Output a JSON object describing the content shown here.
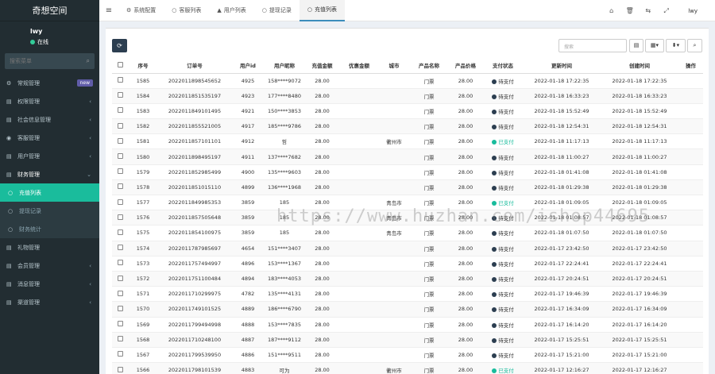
{
  "sidebar": {
    "logo": "奇想空间",
    "user_name": "lwy",
    "user_status": "在线",
    "search_placeholder": "搜索菜单",
    "items": [
      {
        "label": "常规管理",
        "icon": "⚙",
        "badge": "new"
      },
      {
        "label": "权限管理",
        "icon": "▤"
      },
      {
        "label": "社会信息管理",
        "icon": "▤"
      },
      {
        "label": "客服管理",
        "icon": "◉"
      },
      {
        "label": "用户管理",
        "icon": "▤"
      },
      {
        "label": "财务管理",
        "icon": "▤"
      },
      {
        "label": "充值列表",
        "icon": "○"
      },
      {
        "label": "提现记录",
        "icon": "○"
      },
      {
        "label": "财务统计",
        "icon": "○"
      },
      {
        "label": "礼物管理",
        "icon": "▤"
      },
      {
        "label": "会员管理",
        "icon": "▤"
      },
      {
        "label": "消息管理",
        "icon": "▤"
      },
      {
        "label": "渠道管理",
        "icon": "▤"
      }
    ]
  },
  "topbar": {
    "tabs": [
      {
        "label": "系统配置",
        "icon": "⚙"
      },
      {
        "label": "客服列表",
        "icon": "○"
      },
      {
        "label": "用户列表",
        "icon": "▲"
      },
      {
        "label": "提现记录",
        "icon": "○"
      },
      {
        "label": "充值列表",
        "icon": "○"
      }
    ],
    "user": "lwy"
  },
  "toolbar": {
    "search_placeholder": "搜索"
  },
  "table": {
    "headers": [
      "序号",
      "订单号",
      "用户id",
      "用户昵称",
      "充值金额",
      "优惠金额",
      "城市",
      "产品名称",
      "产品价格",
      "支付状态",
      "更新时间",
      "创建时间",
      "操作"
    ],
    "rows": [
      [
        "1585",
        "2022011898545652",
        "4925",
        "158****9072",
        "28.00",
        "",
        "",
        "门票",
        "28.00",
        "待支付",
        "2022-01-18 17:22:35",
        "2022-01-18 17:22:35"
      ],
      [
        "1584",
        "2022011851535197",
        "4923",
        "177****8480",
        "28.00",
        "",
        "",
        "门票",
        "28.00",
        "待支付",
        "2022-01-18 16:33:23",
        "2022-01-18 16:33:23"
      ],
      [
        "1583",
        "2022011849101495",
        "4921",
        "150****3853",
        "28.00",
        "",
        "",
        "门票",
        "28.00",
        "待支付",
        "2022-01-18 15:52:49",
        "2022-01-18 15:52:49"
      ],
      [
        "1582",
        "2022011855521005",
        "4917",
        "185****9786",
        "28.00",
        "",
        "",
        "门票",
        "28.00",
        "待支付",
        "2022-01-18 12:54:31",
        "2022-01-18 12:54:31"
      ],
      [
        "1581",
        "2022011857101101",
        "4912",
        "哲",
        "28.00",
        "",
        "衢州市",
        "门票",
        "28.00",
        "已支付",
        "2022-01-18 11:17:13",
        "2022-01-18 11:17:13"
      ],
      [
        "1580",
        "2022011898495197",
        "4911",
        "137****7682",
        "28.00",
        "",
        "",
        "门票",
        "28.00",
        "待支付",
        "2022-01-18 11:00:27",
        "2022-01-18 11:00:27"
      ],
      [
        "1579",
        "2022011852985499",
        "4900",
        "135****9603",
        "28.00",
        "",
        "",
        "门票",
        "28.00",
        "待支付",
        "2022-01-18 01:41:08",
        "2022-01-18 01:41:08"
      ],
      [
        "1578",
        "2022011851015110",
        "4899",
        "136****1968",
        "28.00",
        "",
        "",
        "门票",
        "28.00",
        "待支付",
        "2022-01-18 01:29:38",
        "2022-01-18 01:29:38"
      ],
      [
        "1577",
        "2022011849985353",
        "3859",
        "185",
        "28.00",
        "",
        "青岛市",
        "门票",
        "28.00",
        "已支付",
        "2022-01-18 01:09:05",
        "2022-01-18 01:09:05"
      ],
      [
        "1576",
        "2022011857505648",
        "3859",
        "185",
        "28.00",
        "",
        "青岛市",
        "门票",
        "28.00",
        "待支付",
        "2022-01-18 01:08:57",
        "2022-01-18 01:08:57"
      ],
      [
        "1575",
        "2022011854100975",
        "3859",
        "185",
        "28.00",
        "",
        "青岛市",
        "门票",
        "28.00",
        "待支付",
        "2022-01-18 01:07:50",
        "2022-01-18 01:07:50"
      ],
      [
        "1574",
        "2022011787985697",
        "4654",
        "151****3407",
        "28.00",
        "",
        "",
        "门票",
        "28.00",
        "待支付",
        "2022-01-17 23:42:50",
        "2022-01-17 23:42:50"
      ],
      [
        "1573",
        "2022011757494997",
        "4896",
        "153****1367",
        "28.00",
        "",
        "",
        "门票",
        "28.00",
        "待支付",
        "2022-01-17 22:24:41",
        "2022-01-17 22:24:41"
      ],
      [
        "1572",
        "2022011751100484",
        "4894",
        "183****4053",
        "28.00",
        "",
        "",
        "门票",
        "28.00",
        "待支付",
        "2022-01-17 20:24:51",
        "2022-01-17 20:24:51"
      ],
      [
        "1571",
        "2022011710299975",
        "4782",
        "135****4131",
        "28.00",
        "",
        "",
        "门票",
        "28.00",
        "待支付",
        "2022-01-17 19:46:39",
        "2022-01-17 19:46:39"
      ],
      [
        "1570",
        "2022011749101525",
        "4889",
        "186****6790",
        "28.00",
        "",
        "",
        "门票",
        "28.00",
        "待支付",
        "2022-01-17 16:34:09",
        "2022-01-17 16:34:09"
      ],
      [
        "1569",
        "2022011799494998",
        "4888",
        "153****7835",
        "28.00",
        "",
        "",
        "门票",
        "28.00",
        "待支付",
        "2022-01-17 16:14:20",
        "2022-01-17 16:14:20"
      ],
      [
        "1568",
        "2022011710248100",
        "4887",
        "187****9112",
        "28.00",
        "",
        "",
        "门票",
        "28.00",
        "待支付",
        "2022-01-17 15:25:51",
        "2022-01-17 15:25:51"
      ],
      [
        "1567",
        "2022011799539950",
        "4886",
        "151****9511",
        "28.00",
        "",
        "",
        "门票",
        "28.00",
        "待支付",
        "2022-01-17 15:21:00",
        "2022-01-17 15:21:00"
      ],
      [
        "1566",
        "2022011798101539",
        "4883",
        "可为",
        "28.00",
        "",
        "衢州市",
        "门票",
        "28.00",
        "已支付",
        "2022-01-17 12:16:27",
        "2022-01-17 12:16:27"
      ]
    ]
  },
  "watermark": "https://www.huzhan.com/ishop44695",
  "colors": {
    "sidebar_bg": "#222d32",
    "active_menu": "#1abc9c",
    "paid": "#18bc9c",
    "unpaid": "#333333"
  }
}
